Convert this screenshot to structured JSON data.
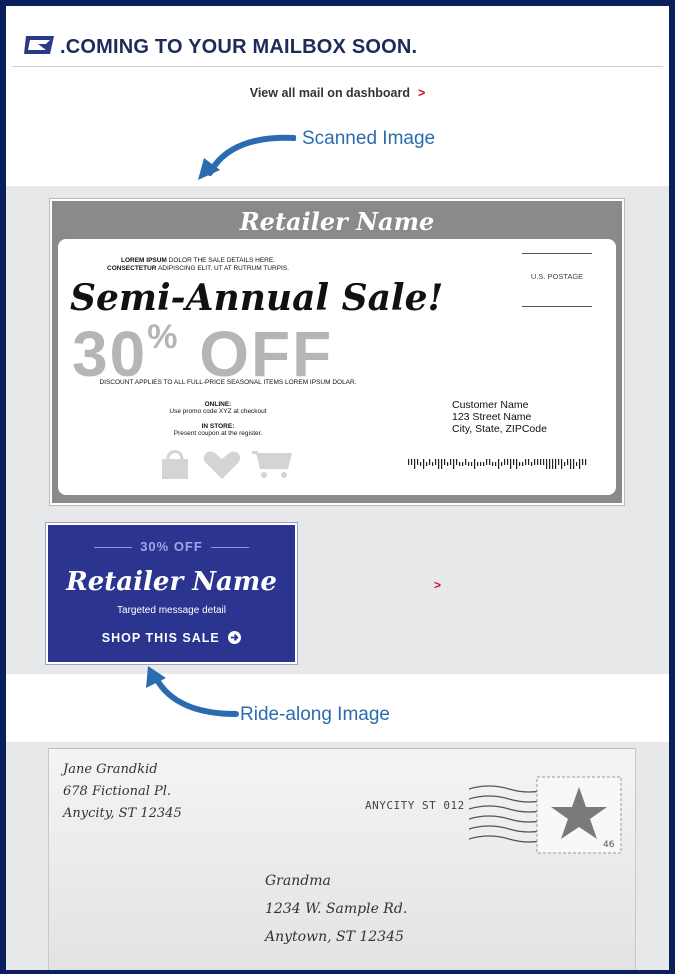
{
  "header": {
    "title": ".COMING TO YOUR MAILBOX SOON.",
    "logo_icon": "usps-eagle-icon"
  },
  "dashboard_link": {
    "label": "View all mail on dashboard",
    "chevron": ">"
  },
  "callouts": {
    "scanned": "Scanned Image",
    "ride_along": "Ride-along Image"
  },
  "mailpiece": {
    "retailer_name": "Retailer Name",
    "lorem_line1_bold": "LOREM IPSUM",
    "lorem_line1_rest": "DOLOR THE SALE DETAILS HERE.",
    "lorem_line2_bold": "CONSECTETUR",
    "lorem_line2_rest": "ADIPISCING ELIT. UT AT RUTRUM TURPIS.",
    "headline": "Semi-Annual Sale!",
    "offer_number": "30",
    "offer_percent": "%",
    "offer_off": "OFF",
    "discount_note": "DISCOUNT APPLIES TO ALL FULL-PRICE SEASONAL ITEMS LOREM IPSUM DOLAR.",
    "online_title": "ONLINE:",
    "online_text": "Use promo code XYZ at checkout",
    "instore_title": "IN STORE:",
    "instore_text": "Present coupon at the register.",
    "postage": "U.S. POSTAGE",
    "address_name": "Customer Name",
    "address_street": "123 Street Name",
    "address_city": "City, State, ZIPCode"
  },
  "ride_along": {
    "top_line": "30% OFF",
    "retailer_name": "Retailer Name",
    "detail": "Targeted message detail",
    "shop": "SHOP THIS SALE",
    "shop_icon": "arrow-circle-right-icon",
    "chevron": ">",
    "background_color": "#2b3590"
  },
  "envelope": {
    "return_line1": "Jane Grandkid",
    "return_line2": "678 Fictional Pl.",
    "return_line3": "Anycity, ST 12345",
    "postmark": "ANYCITY ST 012",
    "to_line1": "Grandma",
    "to_line2": "1234 W. Sample Rd.",
    "to_line3": "Anytown, ST 12345",
    "stamp_value": "46"
  },
  "colors": {
    "frame": "#0b1f5c",
    "accent_red": "#c8102e",
    "callout_blue": "#2b6cb0"
  }
}
